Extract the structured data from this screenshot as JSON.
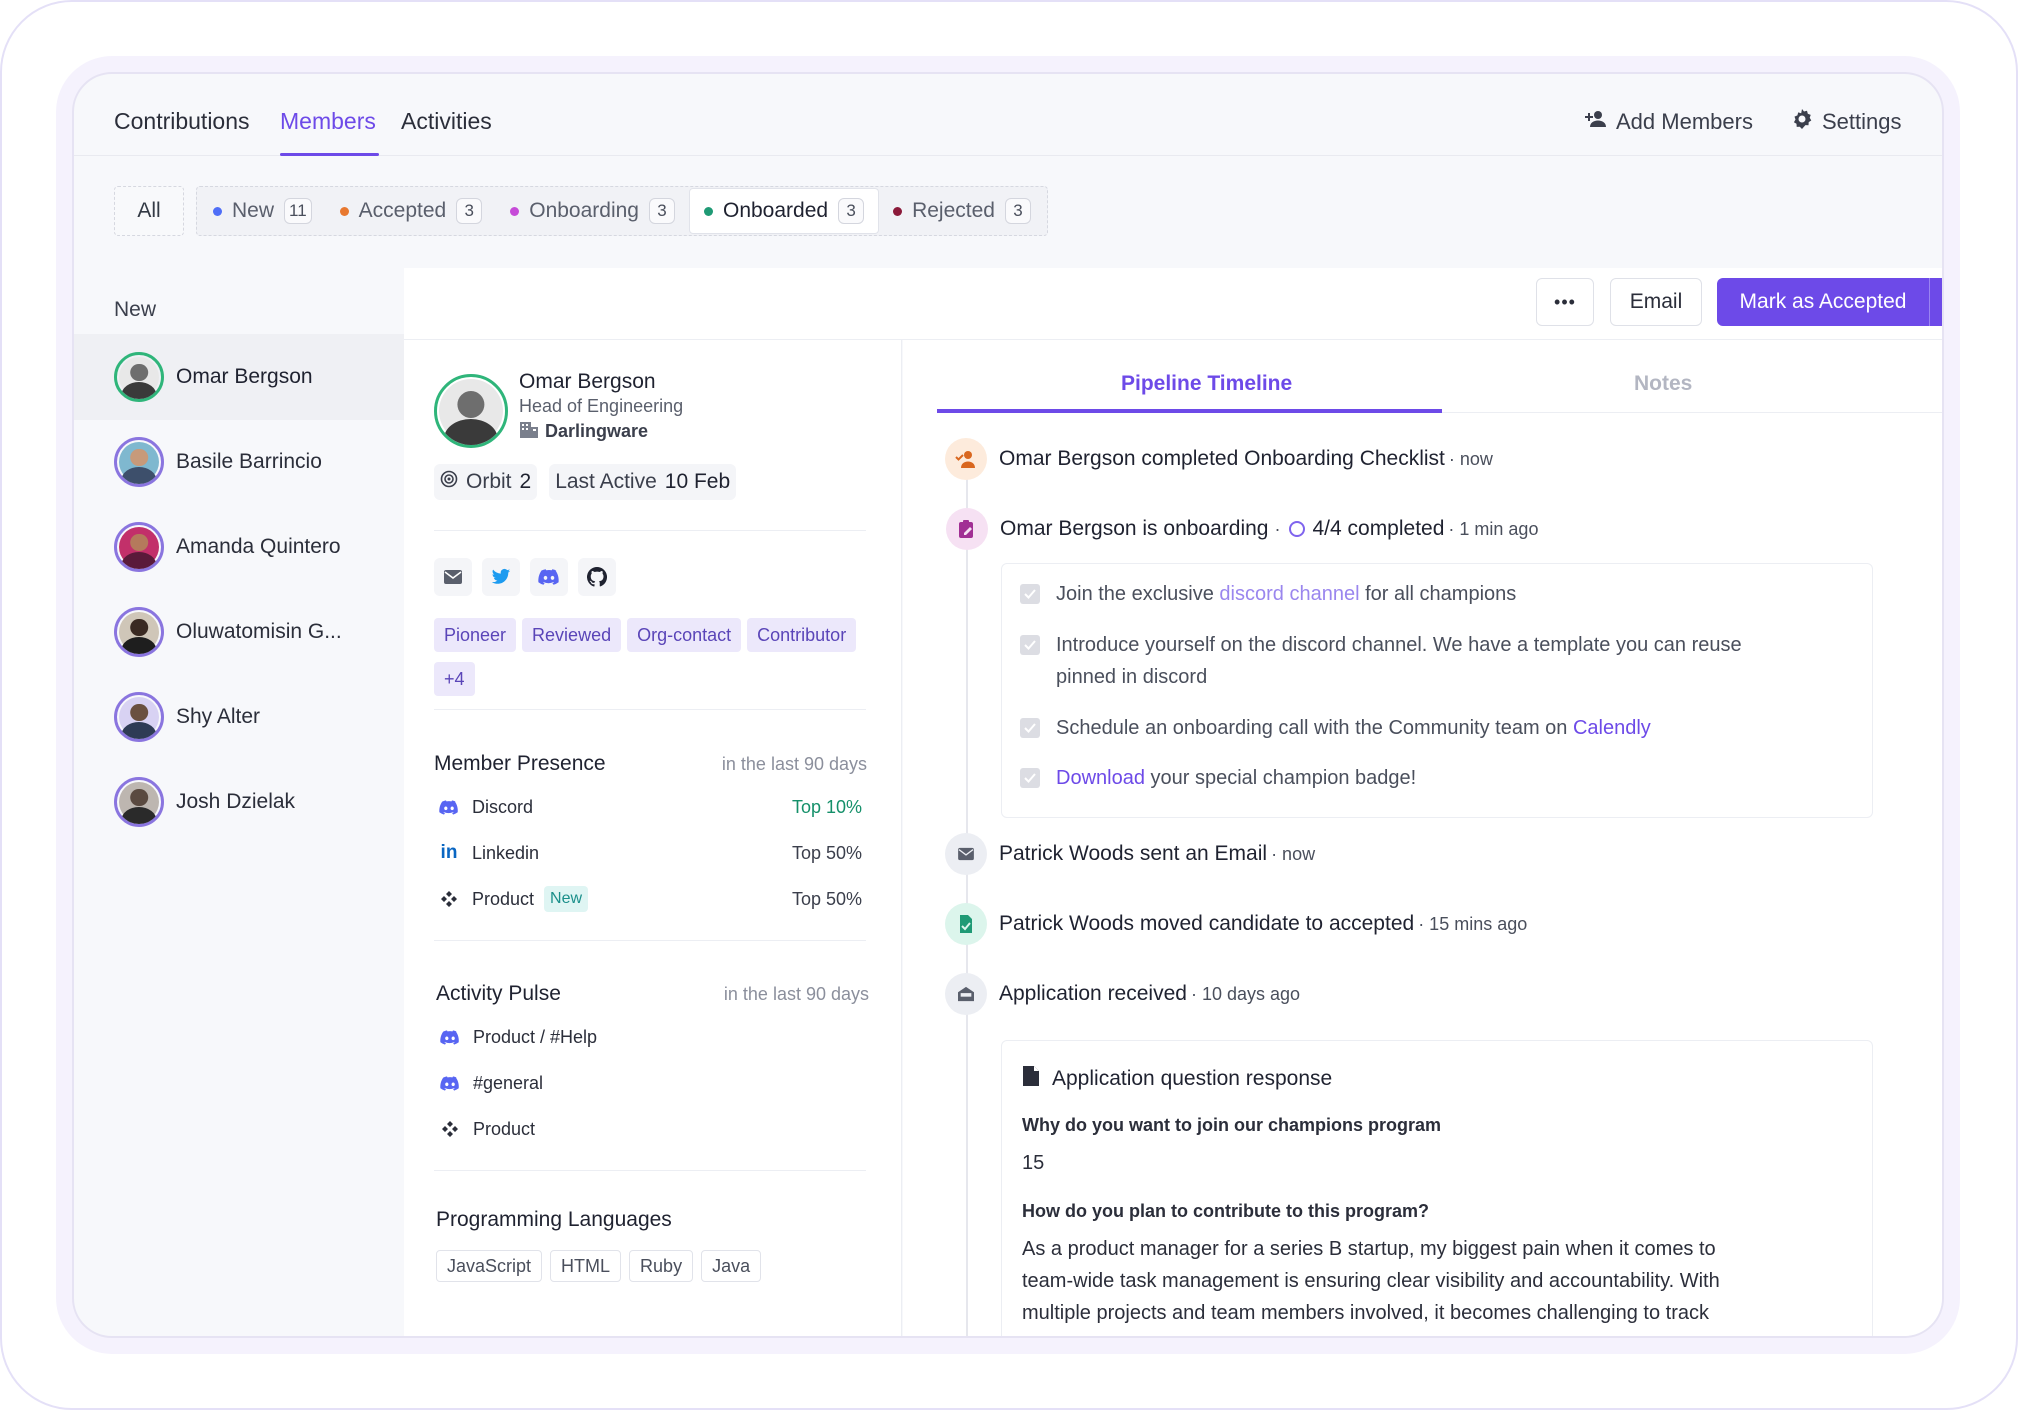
{
  "tabs": [
    {
      "label": "Contributions",
      "active": false
    },
    {
      "label": "Members",
      "active": true
    },
    {
      "label": "Activities",
      "active": false
    }
  ],
  "top_actions": {
    "add_members": "Add Members",
    "settings": "Settings"
  },
  "filters": {
    "all": "All",
    "items": [
      {
        "label": "New",
        "count": "11",
        "color": "#4f6ef7"
      },
      {
        "label": "Accepted",
        "count": "3",
        "color": "#e8782f"
      },
      {
        "label": "Onboarding",
        "count": "3",
        "color": "#c64bd8"
      },
      {
        "label": "Onboarded",
        "count": "3",
        "color": "#1f9a75",
        "selected": true
      },
      {
        "label": "Rejected",
        "count": "3",
        "color": "#8b1a3a"
      }
    ]
  },
  "sidebar": {
    "title": "New",
    "members": [
      {
        "name": "Omar Bergson",
        "selected": true
      },
      {
        "name": "Basile Barrincio"
      },
      {
        "name": "Amanda Quintero"
      },
      {
        "name": "Oluwatomisin G..."
      },
      {
        "name": "Shy Alter"
      },
      {
        "name": "Josh Dzielak"
      }
    ]
  },
  "actionbar": {
    "more": "•••",
    "email": "Email",
    "primary": "Mark as Accepted"
  },
  "profile": {
    "name": "Omar Bergson",
    "role": "Head of Engineering",
    "company": "Darlingware",
    "orbit_label": "Orbit",
    "orbit_value": "2",
    "last_active_label": "Last Active",
    "last_active_value": "10 Feb",
    "tags": [
      "Pioneer",
      "Reviewed",
      "Org-contact",
      "Contributor",
      "+4"
    ],
    "presence": {
      "title": "Member Presence",
      "sub": "in the last 90 days",
      "rows": [
        {
          "label": "Discord",
          "value": "Top 10%"
        },
        {
          "label": "Linkedin",
          "value": "Top 50%"
        },
        {
          "label": "Product",
          "badge": "New",
          "value": "Top 50%"
        }
      ]
    },
    "pulse": {
      "title": "Activity Pulse",
      "sub": "in the last 90 days",
      "rows": [
        {
          "label": "Product / #Help"
        },
        {
          "label": "#general"
        },
        {
          "label": "Product"
        }
      ]
    },
    "languages": {
      "title": "Programming Languages",
      "items": [
        "JavaScript",
        "HTML",
        "Ruby",
        "Java"
      ]
    }
  },
  "timeline": {
    "tabs": {
      "pipeline": "Pipeline Timeline",
      "notes": "Notes"
    },
    "events": [
      {
        "text": "Omar Bergson completed Onboarding Checklist",
        "time": "· now"
      },
      {
        "text": "Omar Bergson is onboarding",
        "progress": "4/4 completed",
        "time": "· 1 min ago"
      },
      {
        "text": "Patrick Woods sent an Email",
        "time": "· now"
      },
      {
        "text": "Patrick Woods moved candidate to accepted",
        "time": "· 15 mins ago"
      },
      {
        "text": "Application received",
        "time": "· 10 days ago"
      }
    ],
    "checklist": {
      "item1_pre": "Join the exclusive ",
      "item1_link": "discord channel",
      "item1_post": " for all champions",
      "item2_line1": "Introduce yourself on the discord channel. We have a template you can reuse",
      "item2_line2": "pinned in discord",
      "item3_pre": "Schedule an onboarding call with the Community team on ",
      "item3_link": "Calendly",
      "item4_link": "Download",
      "item4_post": " your special champion badge!"
    },
    "application": {
      "title": "Application question response",
      "q1": "Why do you want to join our champions program",
      "a1": "15",
      "q2": "How do you plan to contribute to this program?",
      "a2_line1": "As a product manager for a series B startup, my biggest pain when it comes to",
      "a2_line2": "team-wide task management is ensuring clear visibility and accountability. With",
      "a2_line3": "multiple projects and team members involved, it becomes challenging to track"
    }
  },
  "colors": {
    "accent": "#6d4ae8",
    "green": "#15906a"
  }
}
